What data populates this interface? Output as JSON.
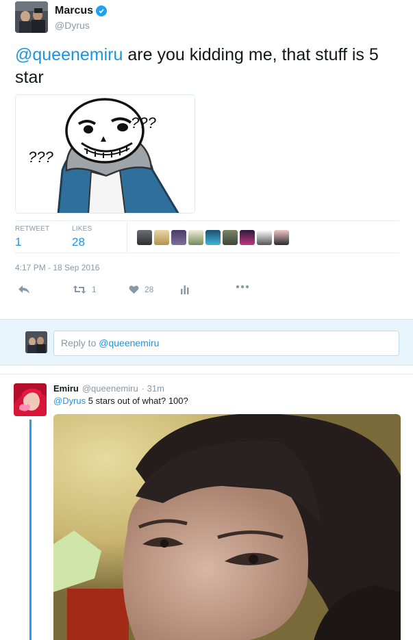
{
  "tweet": {
    "display_name": "Marcus",
    "handle": "@Dyrus",
    "text_mention": "@queenemiru",
    "text_body": " are you kidding me, that stuff is 5 star",
    "media": {
      "caption_left": "???",
      "caption_right": "???"
    },
    "stats": {
      "retweet_label": "RETWEET",
      "retweet_count": "1",
      "likes_label": "LIKES",
      "likes_count": "28"
    },
    "timestamp": "4:17 PM - 18 Sep 2016",
    "actions": {
      "retweet_count": "1",
      "like_count": "28"
    }
  },
  "reply_box": {
    "prefix": "Reply to ",
    "mention": "@queenemiru"
  },
  "reply": {
    "display_name": "Emiru",
    "handle": "@queenemiru",
    "time": "· 31m",
    "mention": "@Dyrus",
    "text": " 5 stars out of what? 100?"
  },
  "colors": {
    "accent": "#1da1f2",
    "link": "#1b95e0",
    "muted": "#8899a6"
  }
}
